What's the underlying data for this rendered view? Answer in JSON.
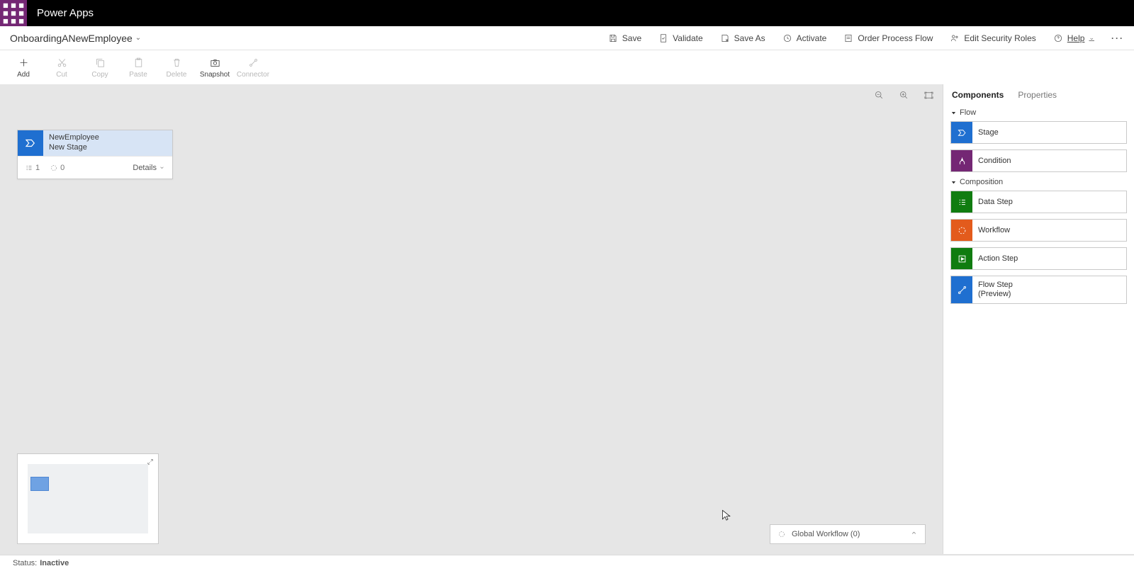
{
  "app": {
    "title": "Power Apps"
  },
  "flow_name": "OnboardingANewEmployee",
  "topcmds": {
    "save": "Save",
    "validate": "Validate",
    "saveas": "Save As",
    "activate": "Activate",
    "order": "Order Process Flow",
    "security": "Edit Security Roles",
    "help": "Help"
  },
  "ribbon": {
    "add": "Add",
    "cut": "Cut",
    "copy": "Copy",
    "paste": "Paste",
    "delete": "Delete",
    "snapshot": "Snapshot",
    "connector": "Connector"
  },
  "stage_card": {
    "line1": "NewEmployee",
    "line2": "New Stage",
    "count1": "1",
    "count2": "0",
    "details": "Details"
  },
  "global_workflow": "Global Workflow (0)",
  "rpanel": {
    "tabs": {
      "components": "Components",
      "properties": "Properties"
    },
    "sections": {
      "flow": "Flow",
      "composition": "Composition"
    },
    "items": {
      "stage": "Stage",
      "condition": "Condition",
      "datastep": "Data Step",
      "workflow": "Workflow",
      "actionstep": "Action Step",
      "flowstep": "Flow Step\n(Preview)"
    }
  },
  "status": {
    "label": "Status:",
    "value": "Inactive"
  }
}
